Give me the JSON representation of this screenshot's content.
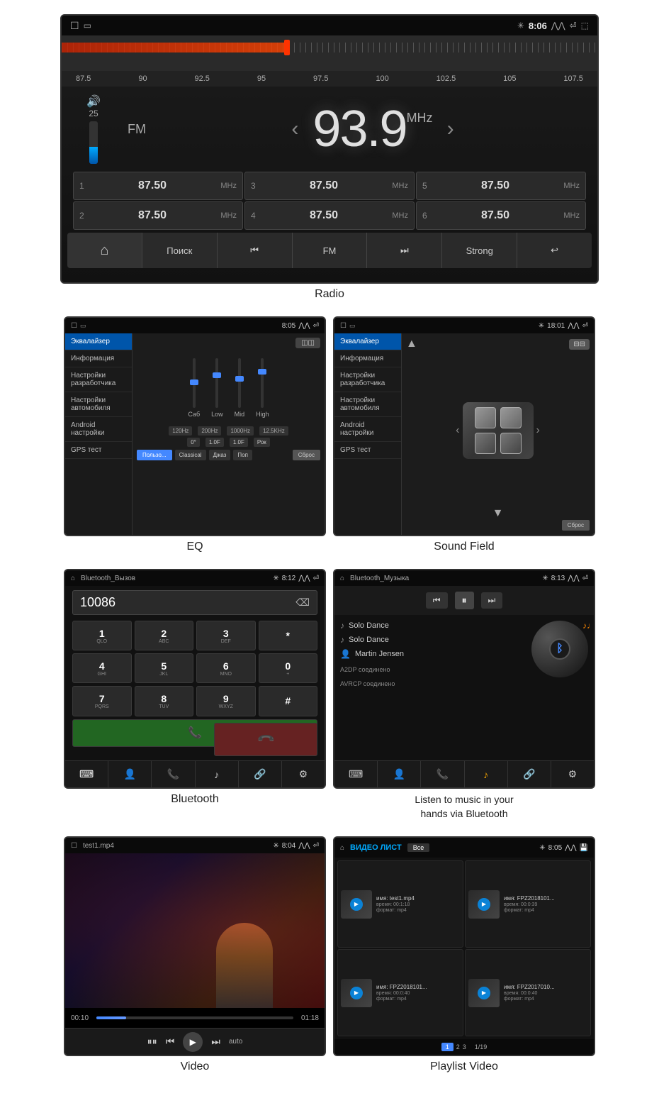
{
  "radio": {
    "label": "Radio",
    "screen": {
      "status": {
        "time": "8:06",
        "bluetooth_icon": "⚡"
      },
      "freq_scale": [
        "87.5",
        "90",
        "92.5",
        "95",
        "97.5",
        "100",
        "102.5",
        "105",
        "107.5"
      ],
      "volume": "25",
      "band": "FM",
      "frequency": "93.9",
      "unit": "MHz",
      "presets": [
        {
          "num": "1",
          "freq": "87.50",
          "unit": "MHz"
        },
        {
          "num": "3",
          "freq": "87.50",
          "unit": "MHz"
        },
        {
          "num": "5",
          "freq": "87.50",
          "unit": "MHz"
        },
        {
          "num": "2",
          "freq": "87.50",
          "unit": "MHz"
        },
        {
          "num": "4",
          "freq": "87.50",
          "unit": "MHz"
        },
        {
          "num": "6",
          "freq": "87.50",
          "unit": "MHz"
        }
      ],
      "controls": [
        "⌂",
        "Поиск",
        "⏮",
        "FM",
        "⏭",
        "Strong",
        "↩"
      ]
    }
  },
  "eq": {
    "label": "EQ",
    "status_time": "8:05",
    "menu_items": [
      "Эквалайзер",
      "Информация",
      "Настройки разработчика",
      "Настройки автомобиля",
      "Android настройки",
      "GPS тест"
    ],
    "active_menu": "Эквалайзер",
    "sliders": [
      {
        "label": "Саб",
        "pos": 50
      },
      {
        "label": "Low",
        "pos": 30
      },
      {
        "label": "Mid",
        "pos": 45
      },
      {
        "label": "High",
        "pos": 60
      }
    ],
    "freq_btns": [
      "120Hz",
      "200Hz",
      "1000Hz",
      "12.5KHz"
    ],
    "values": [
      "0°",
      "1.0F",
      "1.0F",
      "Рок"
    ],
    "presets": [
      "Пользова..",
      "Classical",
      "Джаз",
      "Поп"
    ],
    "active_preset": "Пользова..",
    "reset_label": "Сброс"
  },
  "sound_field": {
    "label": "Sound Field",
    "status_time": "18:01",
    "menu_items": [
      "Эквалайзер",
      "Информация",
      "Настройки разработчика",
      "Настройки автомобиля",
      "Android настройки",
      "GPS тест"
    ],
    "active_menu": "Эквалайзер",
    "reset_label": "Сброс"
  },
  "bluetooth": {
    "label": "Bluetooth",
    "status_time": "8:12",
    "title": "Bluetooth_Вызов",
    "number": "10086",
    "keypad": [
      {
        "main": "1",
        "sub": "QLO"
      },
      {
        "main": "2",
        "sub": "ABC"
      },
      {
        "main": "3",
        "sub": "DEF"
      },
      {
        "main": "*",
        "sub": ""
      },
      {
        "main": "4",
        "sub": "GHI"
      },
      {
        "main": "5",
        "sub": "JKL"
      },
      {
        "main": "6",
        "sub": "MNO"
      },
      {
        "main": "0",
        "sub": "+"
      },
      {
        "main": "7",
        "sub": "PQRS"
      },
      {
        "main": "8",
        "sub": "TUV"
      },
      {
        "main": "9",
        "sub": "WXYZ"
      },
      {
        "main": "#",
        "sub": ""
      }
    ],
    "call_icon": "📞",
    "end_icon": "📞",
    "bottom_btns": [
      "⌨",
      "👤",
      "📞",
      "♪",
      "🔗",
      "⚙"
    ]
  },
  "bluetooth_music": {
    "label": "Listen to music in your\nhands via Bluetooth",
    "status_time": "8:13",
    "title": "Bluetooth_Музыка",
    "prev_icon": "⏮",
    "pause_icon": "⏸",
    "next_icon": "⏭",
    "track": "Solo Dance",
    "album": "Solo Dance",
    "artist": "Martin Jensen",
    "a2dp_status": "A2DP соединено",
    "avrcp_status": "AVRCP соединено",
    "bottom_btns": [
      "⌨",
      "👤",
      "📞",
      "♪",
      "🔗",
      "⚙"
    ]
  },
  "video": {
    "label": "Video",
    "status_time": "8:04",
    "title": "test1.mp4",
    "time_current": "00:10",
    "time_total": "01:18",
    "progress": 15,
    "controls": [
      "⏸⏸",
      "⏮",
      "▶",
      "⏭",
      "auto"
    ]
  },
  "playlist_video": {
    "label": "Playlist Video",
    "status_time": "8:05",
    "title": "ВИДЕО ЛИСТ",
    "filter_label": "Все",
    "items": [
      {
        "name": "имя: test1.mp4",
        "time": "время: 00:1:18",
        "format": "формат: mp4"
      },
      {
        "name": "имя: FPZ2018101...",
        "time": "время: 00:0:39",
        "format": "формат: mp4"
      },
      {
        "name": "имя: FPZ2018101...",
        "time": "время: 00:0:40",
        "format": "формат: mp4"
      },
      {
        "name": "имя: FPZ2017010...",
        "time": "время: 00:0:40",
        "format": "формат: mp4"
      }
    ],
    "pages": [
      "1",
      "2",
      "3"
    ],
    "active_page": "1",
    "total": "1/19"
  }
}
